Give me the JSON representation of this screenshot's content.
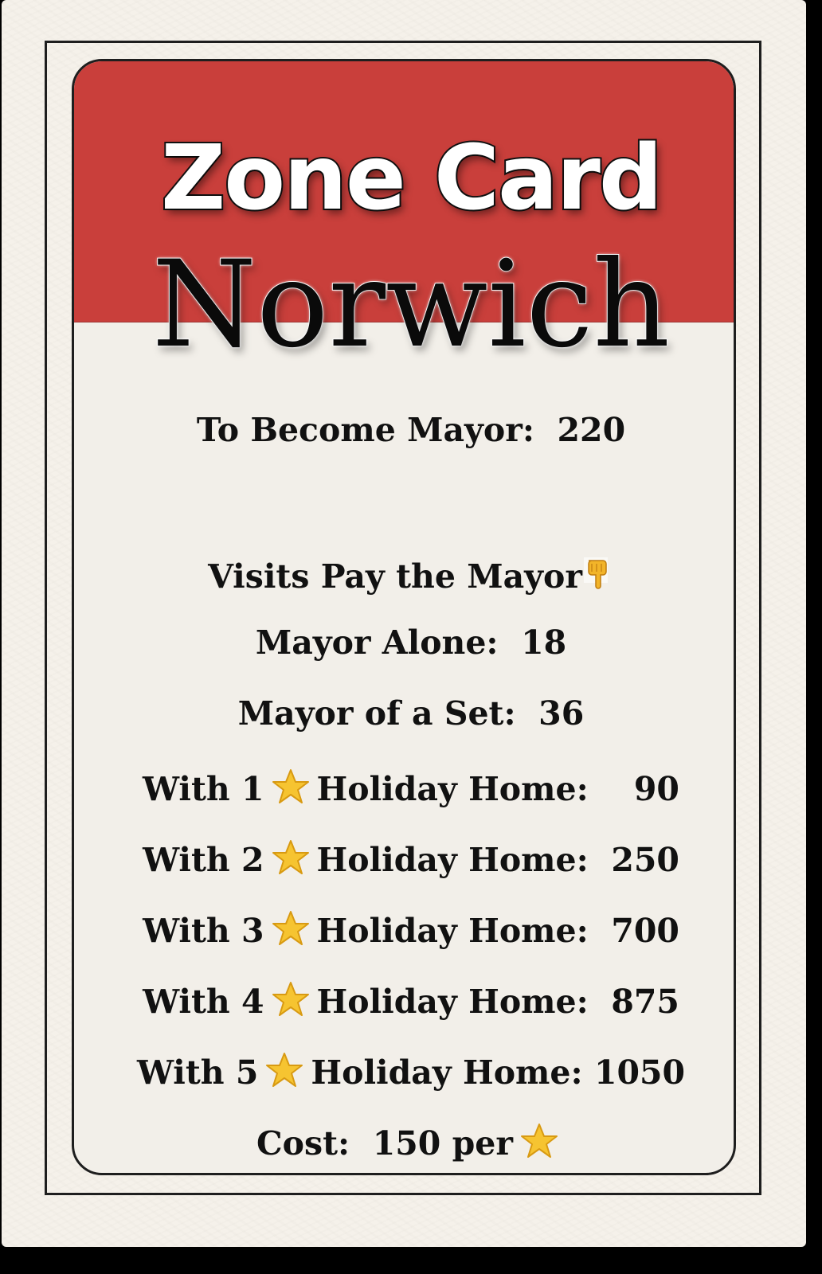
{
  "card": {
    "header": "Zone Card",
    "city": "Norwich",
    "mayor_line": "To Become Mayor:  220",
    "visits_line": "Visits Pay the Mayor",
    "visits_icon": "pointing-down-hand-icon",
    "mayor_alone": "Mayor Alone:  18",
    "mayor_set": "Mayor of a Set:  36",
    "rows": [
      {
        "prefix": "With 1",
        "label": "Holiday Home:",
        "value": "90"
      },
      {
        "prefix": "With 2",
        "label": "Holiday Home:",
        "value": "250"
      },
      {
        "prefix": "With 3",
        "label": "Holiday Home:",
        "value": "700"
      },
      {
        "prefix": "With 4",
        "label": "Holiday Home:",
        "value": "875"
      },
      {
        "prefix": "With 5",
        "label": "Holiday Home:",
        "value": "1050"
      }
    ],
    "row_icon": "star-icon",
    "cost_line": "Cost:  150 per",
    "colors": {
      "header_red": "#c93f3b",
      "card_bg": "#f5f1ea",
      "star": "#f6c431"
    }
  }
}
